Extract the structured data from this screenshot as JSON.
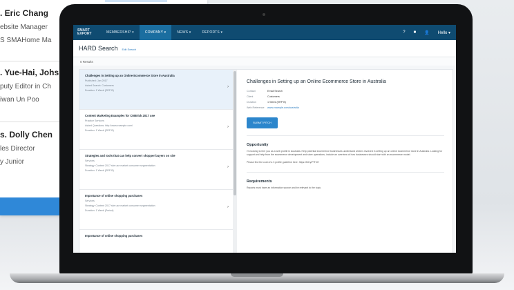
{
  "background_card": {
    "people": [
      {
        "name": ". Eric Chang",
        "lines": [
          "ebsite Manager",
          "S SMAHome Ma"
        ]
      },
      {
        "name": ". Yue-Hai, Johs",
        "lines": [
          "puty Editor in Ch",
          "iwan Un Poo"
        ]
      },
      {
        "name": "s. Dolly Chen",
        "lines": [
          "les Director",
          "y Junior"
        ]
      }
    ]
  },
  "app": {
    "nav": {
      "brand": "SMART EXPORT",
      "items": [
        "MEMBERSHIP ▾",
        "COMPANY ▾",
        "NEWS ▾",
        "REPORTS ▾"
      ],
      "right_icons": [
        "?",
        "■",
        "👤"
      ],
      "user_label": "Hello ▾"
    },
    "page_title": "HARD Search",
    "edit_label": "Edit Search",
    "breadcrumb": "0 Results",
    "results": [
      {
        "title": "Challenges in Setting up an Online Ecommerce Store in Australia",
        "lines": [
          "Published: Jan 2017",
          "Asked Search: Customers",
          "Duration: 1 Week (ERP B)"
        ]
      },
      {
        "title": "Content Marketing Examples for CMBrick 2017 use",
        "lines": [
          "Practice Services",
          "Asked Questions: http://www.example.com/",
          "Duration: 1 Week (ERP B)"
        ]
      },
      {
        "title": "Strategies and tools that can help convert shopper buyers on site",
        "lines": [
          "Services",
          "Strategy: Content 2017 site use market consumer segmentation",
          "Duration: 1 Week (ERP B)"
        ]
      },
      {
        "title": "Importance of online shopping purchases",
        "lines": [
          "Services",
          "Strategy: Content 2017 site use market consumer segmentation",
          "Duration: 1 Week (Period)"
        ]
      },
      {
        "title": "Importance of online shopping purchases",
        "lines": []
      }
    ],
    "detail": {
      "title": "Challenges in Setting up an Online Ecommerce Store in Australia",
      "fields": [
        {
          "k": "Contact",
          "v": "Email Search"
        },
        {
          "k": "Client",
          "v": "Customers"
        },
        {
          "k": "Duration",
          "v": "1 Week (ERP B)"
        },
        {
          "k": "Web Reference",
          "v": "www.example.com/australia",
          "link": true
        }
      ],
      "button": "SUBMIT PITCH",
      "opportunity_heading": "Opportunity",
      "opportunity_text": "I'm looking to hire you as a web profile in Australia. Help potential ecommerce businesses understand what is involved in setting up an online ecommerce store in Australia. Looking for support and help from the ecommerce development and store operations, include an overview of how businesses should start with an ecommerce model.",
      "read_more": "Please find the cost of a 3 profile guideline here: https://bit.ly/PITCH",
      "requirements_heading": "Requirements",
      "requirements_text": "Reports must have an information source and be relevant to the topic."
    }
  }
}
